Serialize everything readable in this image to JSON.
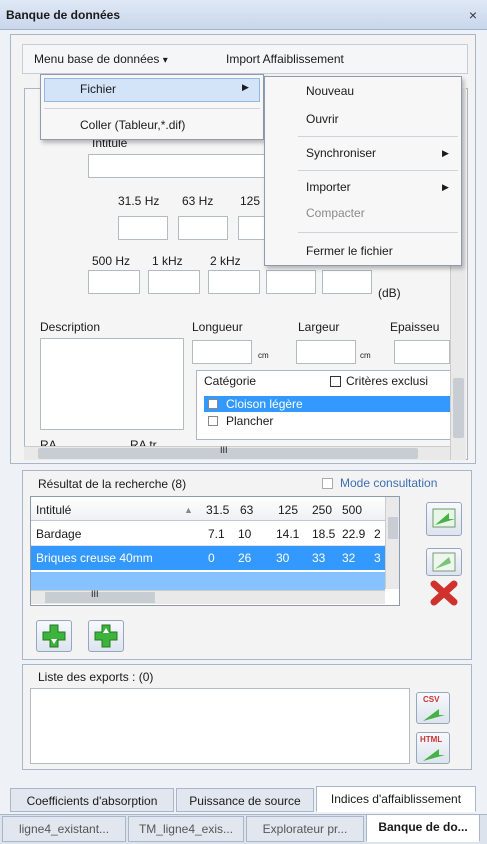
{
  "window": {
    "title": "Banque de données",
    "close": "×"
  },
  "menu": {
    "db_menu": "Menu base de données",
    "arrow": "▾",
    "import": "Import Affaiblissement",
    "items": [
      "Fichier",
      "Coller (Tableur,*.dif)"
    ],
    "submenu_arrow": "▶",
    "sub": [
      "Nouveau",
      "Ouvrir",
      "Synchroniser",
      "Importer",
      "Compacter",
      "Fermer le fichier"
    ]
  },
  "form": {
    "intitule": "Intitulé",
    "freqs": [
      "31.5 Hz",
      "63 Hz",
      "125"
    ],
    "freqs2": [
      "500 Hz",
      "1 kHz",
      "2 kHz"
    ],
    "db_unit": "(dB)",
    "description": "Description",
    "longueur": "Longueur",
    "largeur": "Largeur",
    "epaisseur": "Epaisseu",
    "cm": "cm",
    "categorie": "Catégorie",
    "criteres": "Critères exclusi",
    "categories": [
      "Cloison légère",
      "Plancher"
    ],
    "ra": "RA",
    "ratr": "RA tr",
    "hscroll": "III"
  },
  "results": {
    "title": "Résultat de la recherche",
    "count": "(8)",
    "mode": "Mode consultation",
    "headers": [
      "Intitulé",
      "31.5",
      "63",
      "125",
      "250",
      "500",
      "2"
    ],
    "rows": [
      [
        "Bardage",
        "7.1",
        "10",
        "14.1",
        "18.5",
        "22.9",
        "2"
      ],
      [
        "Briques creuse 40mm",
        "0",
        "26",
        "30",
        "33",
        "32",
        "3"
      ]
    ]
  },
  "exports": {
    "title": "Liste des exports : (0)",
    "csv": "CSV",
    "html": "HTML"
  },
  "tabs": [
    "Coefficients d'absorption",
    "Puissance de source",
    "Indices d'affaiblissement"
  ],
  "doctabs": [
    "ligne4_existant...",
    "TM_ligne4_exis...",
    "Explorateur pr...",
    "Banque de do..."
  ]
}
